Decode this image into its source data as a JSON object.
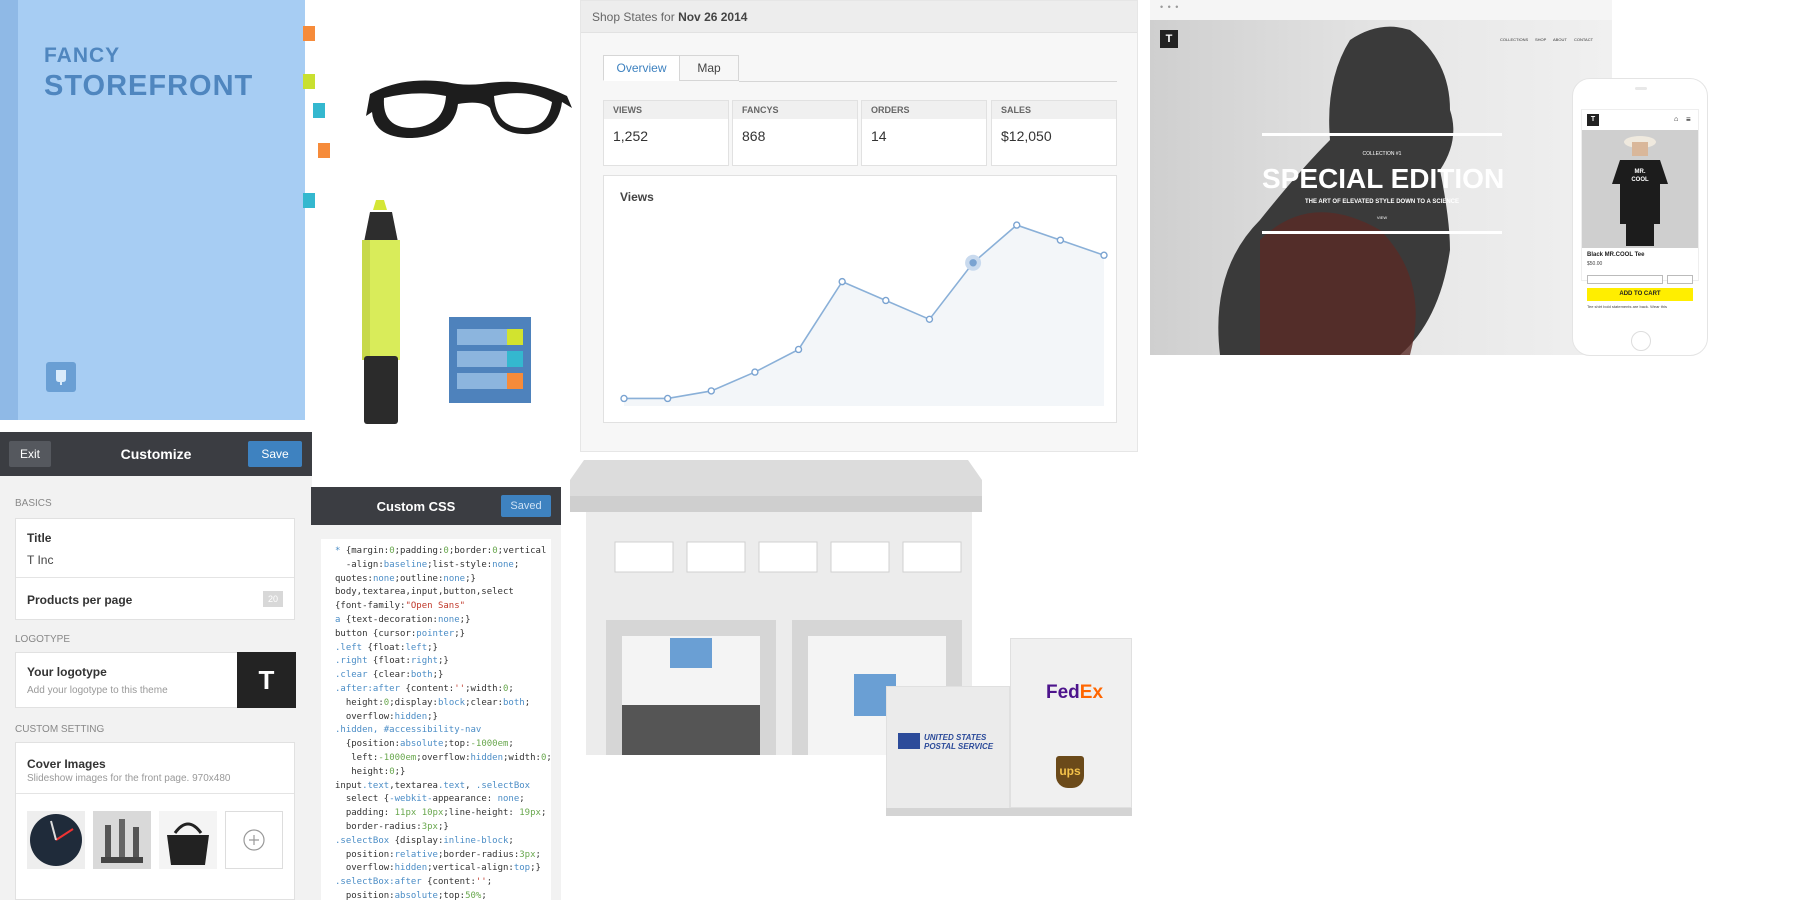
{
  "colors": {
    "book": "#a7cdf3",
    "accent": "#3e82c0",
    "dark": "#3b3d42",
    "chart_line": "#8ab0d8",
    "ups_brown": "#6b4a1a",
    "fedex_purple": "#4d148c",
    "fedex_orange": "#ff6600",
    "cta_yellow": "#ffee00"
  },
  "storefront": {
    "line1": "FANCY",
    "line2": "STOREFRONT",
    "logo_icon": "store-logo-icon"
  },
  "customize": {
    "exit_label": "Exit",
    "title": "Customize",
    "save_label": "Save",
    "basics_section": "BASICS",
    "title_label": "Title",
    "title_value": "T Inc",
    "products_label": "Products per page",
    "products_value": "20",
    "logotype_section": "LOGOTYPE",
    "logotype_label": "Your logotype",
    "logotype_hint": "Add your logotype to this theme",
    "logotype_mark": "T",
    "custom_section": "CUSTOM SETTING",
    "cover_label": "Cover Images",
    "cover_hint": "Slideshow images for the front page. 970x480",
    "add_icon": "plus-circle-icon"
  },
  "custom_css": {
    "title": "Custom CSS",
    "saved_label": "Saved"
  },
  "stats": {
    "header_prefix": "Shop States for",
    "header_date": "Nov 26 2014",
    "tabs": [
      {
        "label": "Overview",
        "active": true
      },
      {
        "label": "Map",
        "active": false
      }
    ],
    "cards": [
      {
        "label": "VIEWS",
        "value": "1,252"
      },
      {
        "label": "FANCYS",
        "value": "868"
      },
      {
        "label": "ORDERS",
        "value": "14"
      },
      {
        "label": "SALES",
        "value": "$12,050"
      }
    ],
    "chart_title": "Views"
  },
  "chart_data": {
    "type": "line",
    "title": "Views",
    "series": [
      {
        "values": [
          2,
          2,
          4,
          9,
          15,
          33,
          28,
          23,
          38,
          48,
          44,
          40
        ]
      }
    ],
    "highlight_index": 8,
    "ylim": [
      0,
      52
    ],
    "grid": false
  },
  "mockup": {
    "dots": "• • •",
    "brand_mark": "T",
    "nav": [
      "COLLECTIONS",
      "SHOP",
      "ABOUT",
      "CONTACT"
    ],
    "kicker": "COLLECTION #1",
    "headline": "SPECIAL EDITION",
    "tagline": "THE ART OF ELEVATED STYLE DOWN TO A SCIENCE",
    "small": "VIEW"
  },
  "phone": {
    "brand_mark": "T",
    "product_shirt_text": "MR. COOL",
    "product_name": "Black MR.COOL Tee",
    "price": "$50.00",
    "cta": "ADD TO CART",
    "note": "Tee shirt bold statements are back. Wear this"
  },
  "shipping": {
    "fedex_a": "Fed",
    "fedex_b": "Ex",
    "usps_line1": "UNITED STATES",
    "usps_line2": "POSTAL SERVICE",
    "ups": "ups"
  }
}
